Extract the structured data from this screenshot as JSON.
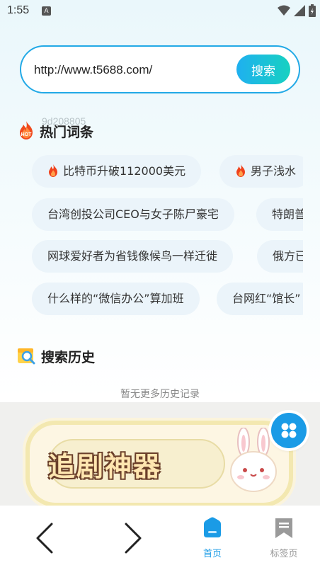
{
  "status_bar": {
    "time": "1:55",
    "badge": "A"
  },
  "search": {
    "url_value": "http://www.t5688.com/",
    "button_label": "搜索"
  },
  "hot": {
    "watermark": "9d208805",
    "title": "热门词条",
    "tags": [
      {
        "label": "比特币升破112000美元",
        "flame": true
      },
      {
        "label": "男子浅水",
        "flame": true
      },
      {
        "label": "台湾创投公司CEO与女子陈尸豪宅",
        "flame": false
      },
      {
        "label": "特朗普",
        "flame": false
      },
      {
        "label": "网球爱好者为省钱像候鸟一样迁徙",
        "flame": false
      },
      {
        "label": "俄方已",
        "flame": false
      },
      {
        "label": "什么样的“微信办公”算加班",
        "flame": false
      },
      {
        "label": "台网红“馆长”",
        "flame": false
      }
    ]
  },
  "history": {
    "title": "搜索历史",
    "empty_text": "暂无更多历史记录"
  },
  "banner": {
    "text": "追剧神器"
  },
  "nav": {
    "home_label": "首页",
    "bookmarks_label": "标签页"
  },
  "colors": {
    "accent": "#22a9e6",
    "active_nav": "#1a9be6",
    "inactive_nav": "#999999"
  },
  "icons": [
    "back-arrow-icon",
    "forward-arrow-icon",
    "home-icon",
    "bookmark-icon",
    "fire-icon",
    "search-history-icon",
    "grid-menu-icon"
  ]
}
